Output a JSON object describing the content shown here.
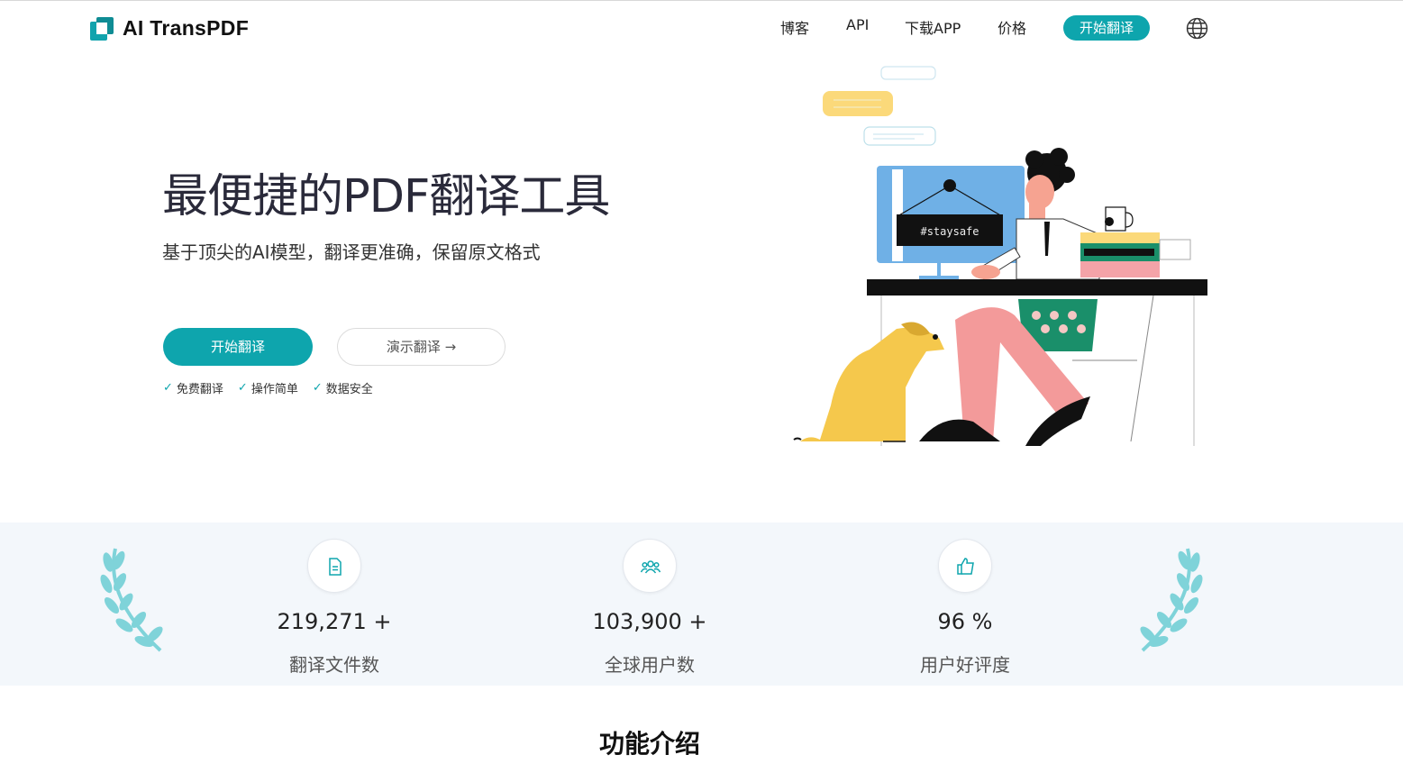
{
  "header": {
    "brand": "AI TransPDF",
    "nav": [
      "博客",
      "API",
      "下载APP",
      "价格"
    ],
    "cta": "开始翻译",
    "globe_icon": "globe-icon"
  },
  "hero": {
    "title": "最便捷的PDF翻译工具",
    "subtitle": "基于顶尖的AI模型，翻译更准确，保留原文格式",
    "primary_button": "开始翻译",
    "secondary_button": "演示翻译 →",
    "features": [
      "免费翻译",
      "操作简单",
      "数据安全"
    ],
    "illustration_sign": "#staysafe"
  },
  "stats": [
    {
      "icon": "document-icon",
      "value": "219,271 +",
      "label": "翻译文件数"
    },
    {
      "icon": "users-icon",
      "value": "103,900 +",
      "label": "全球用户数"
    },
    {
      "icon": "thumbs-up-icon",
      "value": "96 %",
      "label": "用户好评度"
    }
  ],
  "section": {
    "title": "功能介绍"
  },
  "colors": {
    "accent": "#0ea5ad",
    "band": "#f3f7fb",
    "laurel": "#7fd3d9"
  }
}
